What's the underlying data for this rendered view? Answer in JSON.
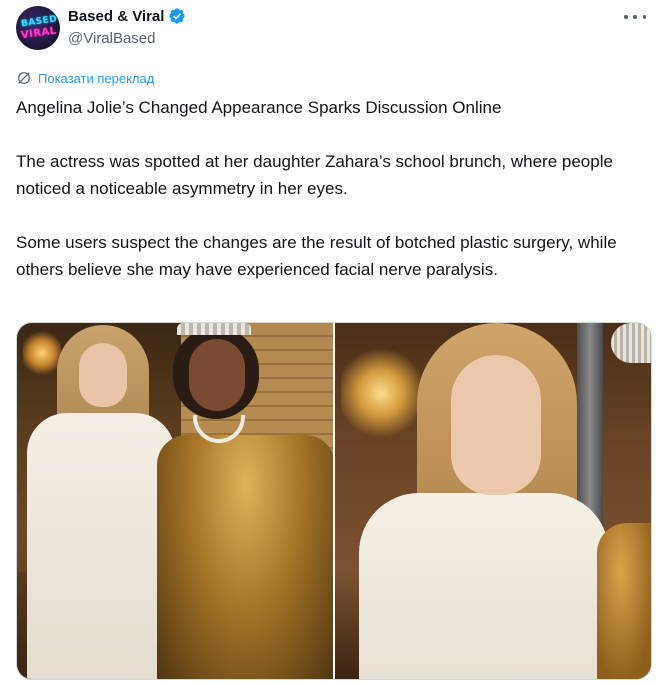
{
  "author": {
    "display_name": "Based & Viral",
    "handle": "@ViralBased",
    "avatar_text_top": "BASED",
    "avatar_text_bottom": "VIRAL",
    "verified": true,
    "verified_color": "#1d9bf0"
  },
  "actions": {
    "more_icon": "more-horizontal-icon"
  },
  "translate": {
    "icon": "translate-icon",
    "label": "Показати переклад",
    "color": "#1d9bf0"
  },
  "post": {
    "paragraphs": [
      "Angelina Jolie’s Changed Appearance Sparks Discussion Online",
      "The actress was spotted at her daughter Zahara’s school brunch, where people noticed a noticeable asymmetry in her eyes.",
      "Some users suspect the changes are the result of botched plastic surgery, while others believe she may have experienced facial nerve paralysis."
    ]
  },
  "media": {
    "count": 2
  }
}
